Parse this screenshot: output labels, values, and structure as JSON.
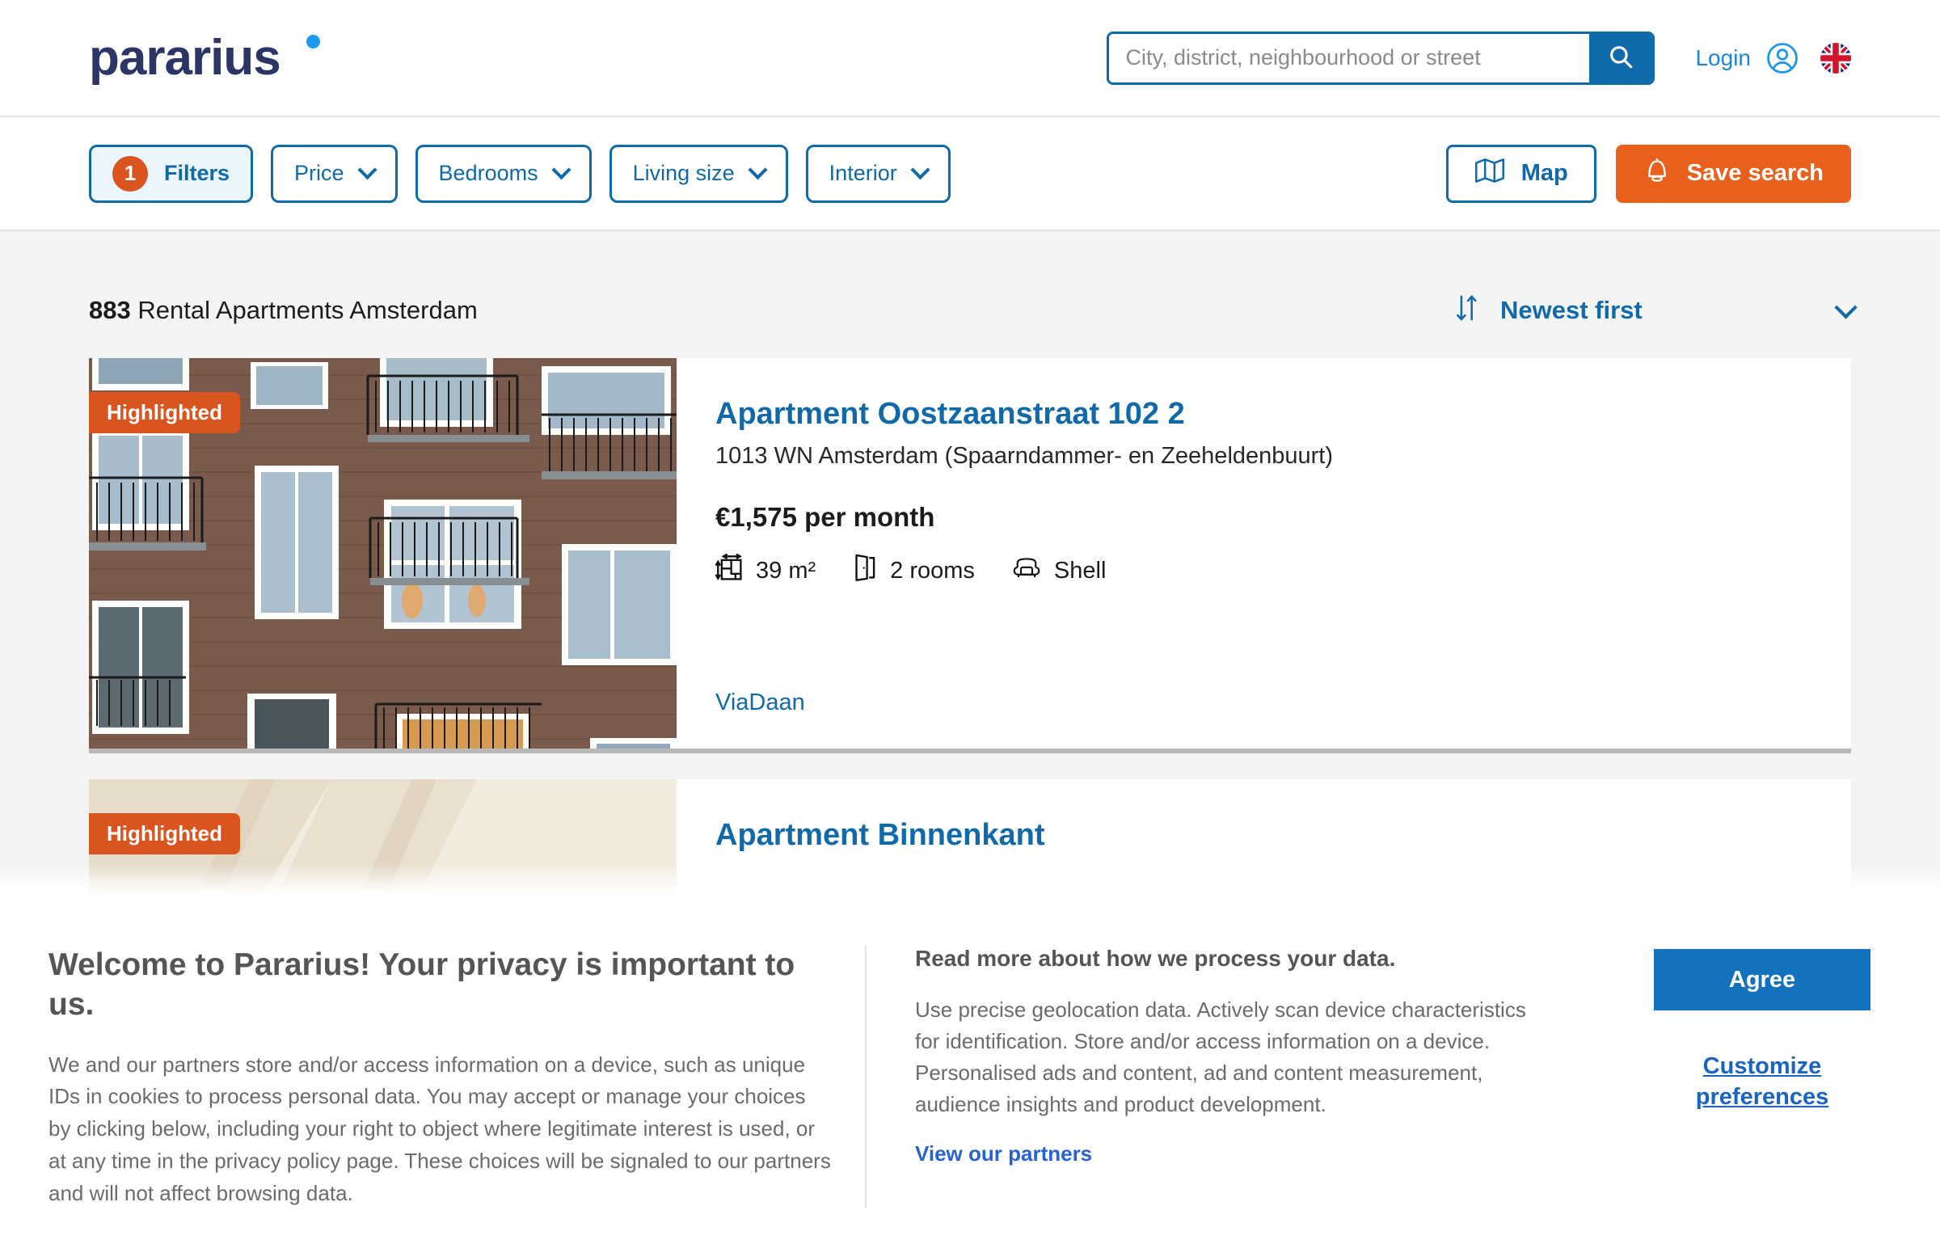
{
  "header": {
    "logo_text": "pararius",
    "logo_dot": "brand-dot",
    "search": {
      "placeholder": "City, district, neighbourhood or street",
      "value": "",
      "button_icon": "search-icon"
    },
    "login_label": "Login",
    "avatar_icon": "user-circle-icon",
    "language_flag": "uk-flag-icon"
  },
  "filterbar": {
    "filters": {
      "label": "Filters",
      "count": "1"
    },
    "dropdowns": [
      {
        "label": "Price"
      },
      {
        "label": "Bedrooms"
      },
      {
        "label": "Living size"
      },
      {
        "label": "Interior"
      }
    ],
    "map_button": {
      "label": "Map",
      "icon": "map-icon"
    },
    "save_button": {
      "label": "Save search",
      "icon": "bell-icon"
    }
  },
  "results": {
    "count": "883",
    "count_suffix": "Rental Apartments Amsterdam",
    "sort": {
      "label": "Newest first",
      "icon": "sort-arrows-icon"
    },
    "listings": [
      {
        "badge": "Highlighted",
        "title": "Apartment Oostzaanstraat 102 2",
        "address": "1013 WN Amsterdam (Spaarndammer- en Zeeheldenbuurt)",
        "price": "€1,575 per month",
        "size": "39 m²",
        "rooms": "2 rooms",
        "interior": "Shell",
        "agent": "ViaDaan"
      },
      {
        "badge": "Highlighted",
        "title": "Apartment Binnenkant"
      }
    ]
  },
  "cookie_banner": {
    "heading": "Welcome to Pararius! Your privacy is important to us.",
    "body": "We and our partners store and/or access information on a device, such as unique IDs in cookies to process personal data. You may accept or manage your choices by clicking below, including your right to object where legitimate interest is used, or at any time in the privacy policy page. These choices will be signaled to our partners and will not affect browsing data.",
    "right_heading": "Read more about how we process your data.",
    "right_body": "Use precise geolocation data. Actively scan device characteristics for identification. Store and/or access information on a device. Personalised ads and content, ad and content measurement, audience insights and product development.",
    "partners_link": "View our partners",
    "agree_label": "Agree",
    "customize_label": "Customize preferences"
  },
  "colors": {
    "brand_navy": "#2b3566",
    "brand_blue": "#1069a8",
    "accent_orange": "#e8601c",
    "badge_orange": "#d9541e",
    "page_bg": "#f4f4f4"
  }
}
